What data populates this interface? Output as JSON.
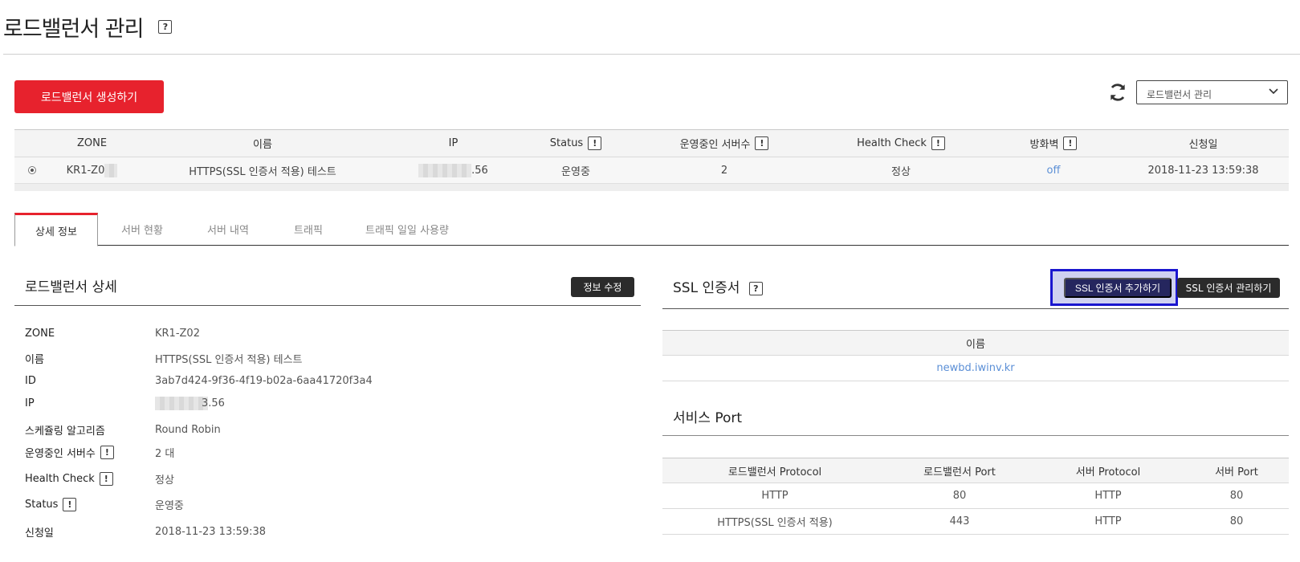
{
  "page": {
    "title": "로드밸런서 관리",
    "help": "?"
  },
  "toolbar": {
    "create_label": "로드밸런서 생성하기",
    "select_value": "로드밸런서 관리"
  },
  "lb_table": {
    "headers": [
      "ZONE",
      "이름",
      "IP",
      "Status",
      "운영중인 서버수",
      "Health Check",
      "방화벽",
      "신청일"
    ],
    "info_mark": "!",
    "row": {
      "zone": "KR1-Z0",
      "name": "HTTPS(SSL 인증서 적용) 테스트",
      "ip_suffix": ".56",
      "status": "운영중",
      "servers": "2",
      "health": "정상",
      "firewall": "off",
      "date": "2018-11-23 13:59:38"
    }
  },
  "tabs": [
    "상세 정보",
    "서버 현황",
    "서버 내역",
    "트래픽",
    "트래픽 일일 사용량"
  ],
  "detail": {
    "title": "로드밸런서 상세",
    "edit_label": "정보 수정",
    "rows": [
      {
        "label": "ZONE",
        "value": "KR1-Z02"
      },
      {
        "label": "이름",
        "value": "HTTPS(SSL 인증서 적용) 테스트"
      },
      {
        "label": "ID",
        "value": "3ab7d424-9f36-4f19-b02a-6aa41720f3a4"
      },
      {
        "label": "IP",
        "value": "3.56"
      },
      {
        "label": "스케쥴링 알고리즘",
        "value": "Round Robin"
      },
      {
        "label": "운영중인 서버수",
        "value": "2 대"
      },
      {
        "label": "Health Check",
        "value": "정상"
      },
      {
        "label": "Status",
        "value": "운영중"
      },
      {
        "label": "신청일",
        "value": "2018-11-23 13:59:38"
      }
    ]
  },
  "ssl": {
    "title": "SSL 인증서",
    "add_label": "SSL 인증서 추가하기",
    "manage_label": "SSL 인증서 관리하기",
    "table_header": "이름",
    "cert_name": "newbd.iwinv.kr"
  },
  "service_port": {
    "title": "서비스 Port",
    "headers": [
      "로드밸런서 Protocol",
      "로드밸런서 Port",
      "서버 Protocol",
      "서버 Port"
    ],
    "rows": [
      [
        "HTTP",
        "80",
        "HTTP",
        "80"
      ],
      [
        "HTTPS(SSL 인증서 적용)",
        "443",
        "HTTP",
        "80"
      ]
    ]
  },
  "colors": {
    "brand_red": "#e7222d",
    "dark_button": "#2b2b2b",
    "link_blue": "#5b8fd6",
    "highlight_border": "#1a16cf"
  }
}
